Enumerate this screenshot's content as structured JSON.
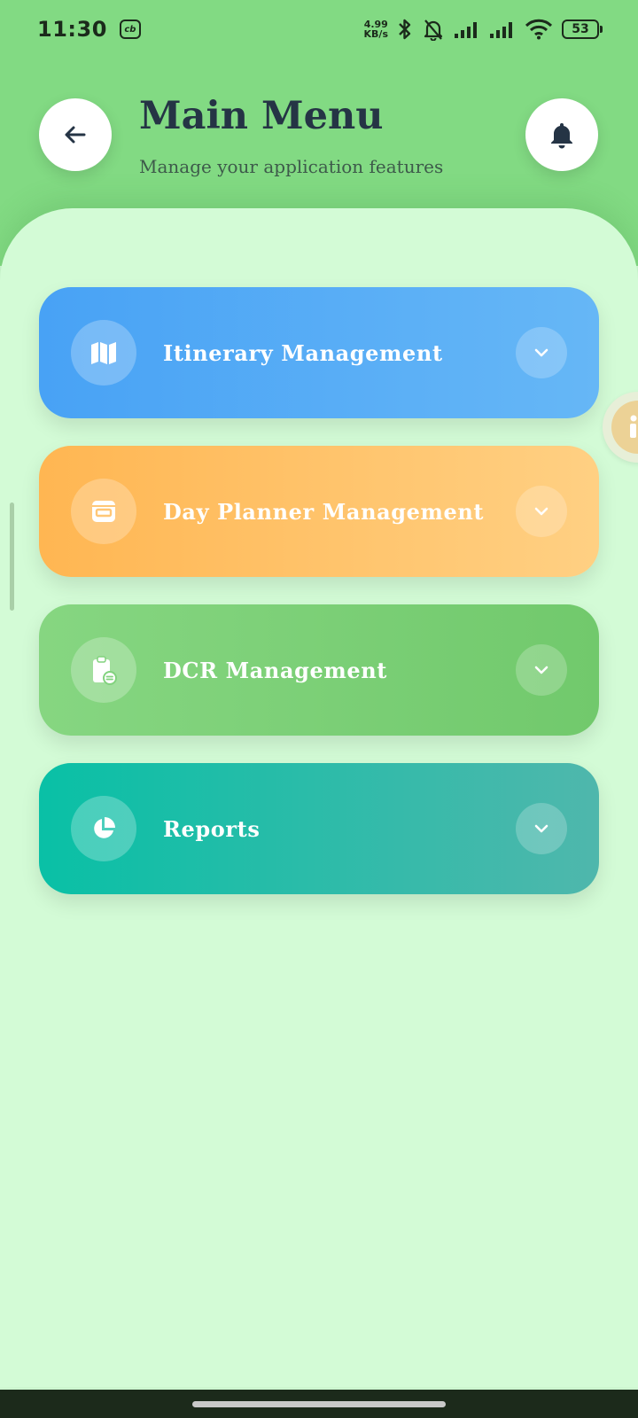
{
  "status_bar": {
    "time": "11:30",
    "app_badge": "cb",
    "net_speed_value": "4.99",
    "net_speed_unit": "KB/s",
    "battery": "53"
  },
  "header": {
    "title": "Main Menu",
    "subtitle": "Manage your application features",
    "back_icon": "arrow-left-icon",
    "notification_icon": "bell-icon"
  },
  "menu": {
    "items": [
      {
        "label": "Itinerary Management",
        "icon": "map-icon",
        "color_start": "#48a2f5",
        "color_end": "#66b7f6"
      },
      {
        "label": "Day Planner Management",
        "icon": "calendar-icon",
        "color_start": "#ffb652",
        "color_end": "#ffd083"
      },
      {
        "label": "DCR Management",
        "icon": "clipboard-sync-icon",
        "color_start": "#86d681",
        "color_end": "#71c96c"
      },
      {
        "label": "Reports",
        "icon": "pie-chart-icon",
        "color_start": "#09c0a6",
        "color_end": "#4fb7ac"
      }
    ]
  },
  "colors": {
    "header_bg": "#82da83",
    "content_bg": "#d3fbd6",
    "title_text": "#253445"
  }
}
